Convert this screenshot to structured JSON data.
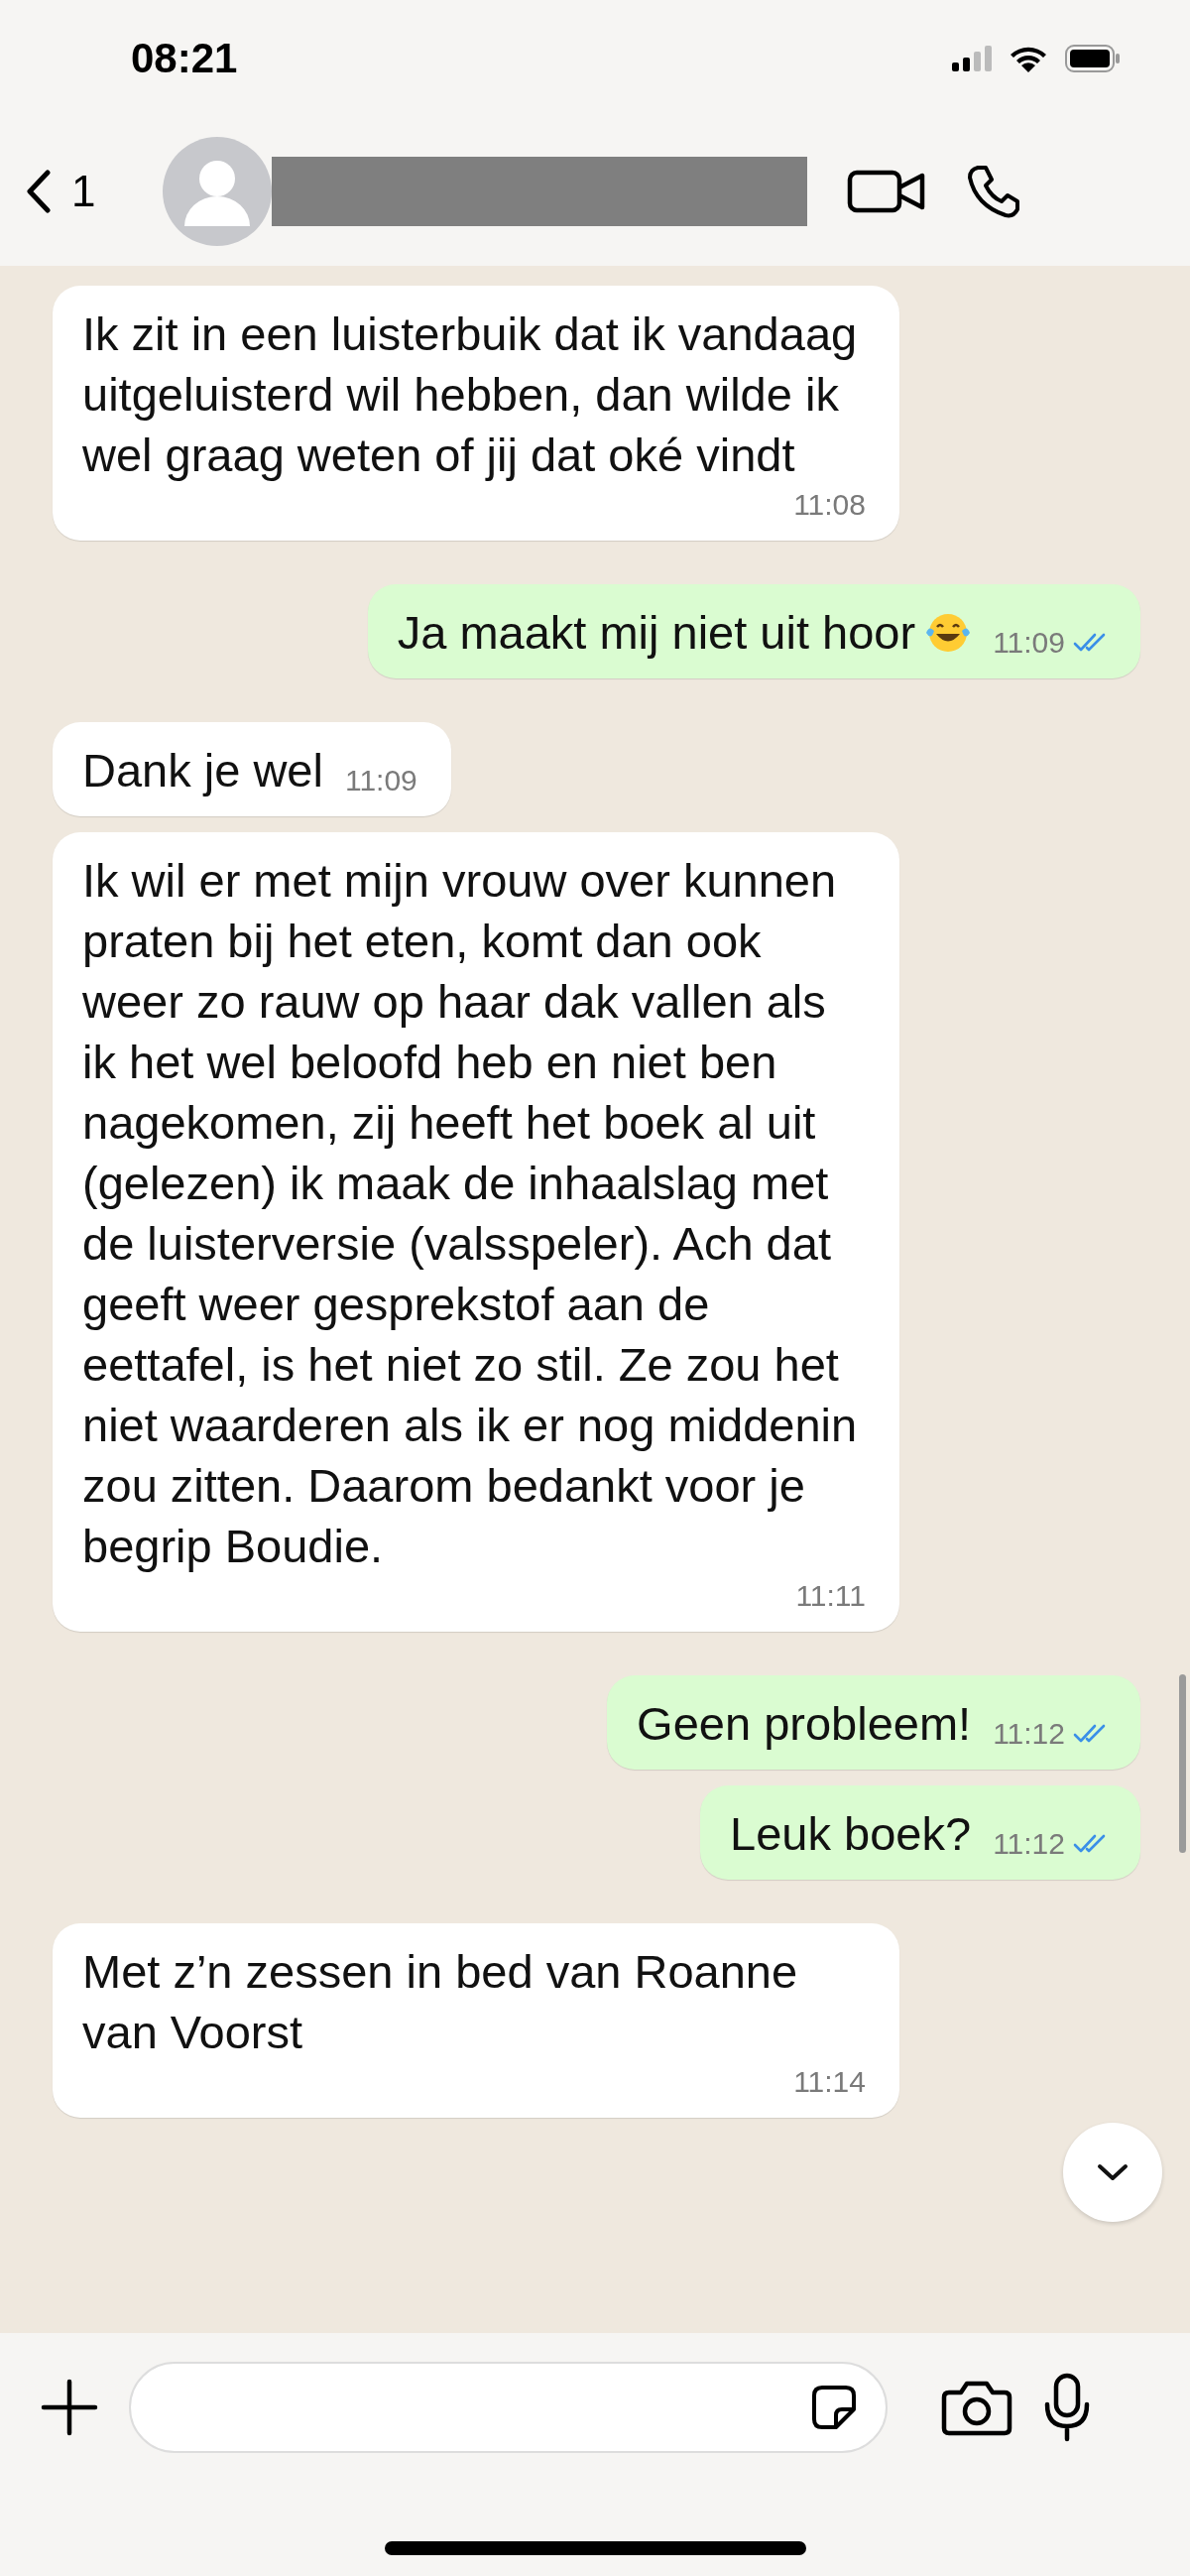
{
  "status_bar": {
    "time": "08:21"
  },
  "header": {
    "unread_count": "1"
  },
  "messages": [
    {
      "kind": "incoming",
      "text": "Ik zit in een luisterbuik dat ik vandaag uitgeluisterd wil hebben, dan wilde ik wel graag weten of jij dat oké vindt",
      "time": "11:08"
    },
    {
      "kind": "outgoing",
      "text": "Ja maakt mij niet uit hoor",
      "has_emoji": true,
      "time": "11:09",
      "read": true
    },
    {
      "kind": "incoming",
      "text": "Dank je wel",
      "time": "11:09"
    },
    {
      "kind": "incoming",
      "text": "Ik wil er met mijn vrouw over kunnen praten bij het eten, komt dan ook weer zo rauw op haar dak vallen als ik het wel beloofd heb en niet ben nagekomen, zij heeft het boek al uit (gelezen) ik maak de inhaalslag met de luisterversie (valsspeler). Ach dat geeft weer gesprekstof aan de eettafel, is het niet zo stil. Ze zou het niet waarderen als ik er nog middenin zou zitten. Daarom bedankt voor je begrip Boudie.",
      "time": "11:11"
    },
    {
      "kind": "outgoing",
      "text": "Geen probleem!",
      "time": "11:12",
      "read": true
    },
    {
      "kind": "outgoing",
      "text": "Leuk boek?",
      "time": "11:12",
      "read": true
    },
    {
      "kind": "incoming",
      "text": "Met z’n zessen in bed van Roanne van Voorst",
      "time": "11:14"
    }
  ]
}
